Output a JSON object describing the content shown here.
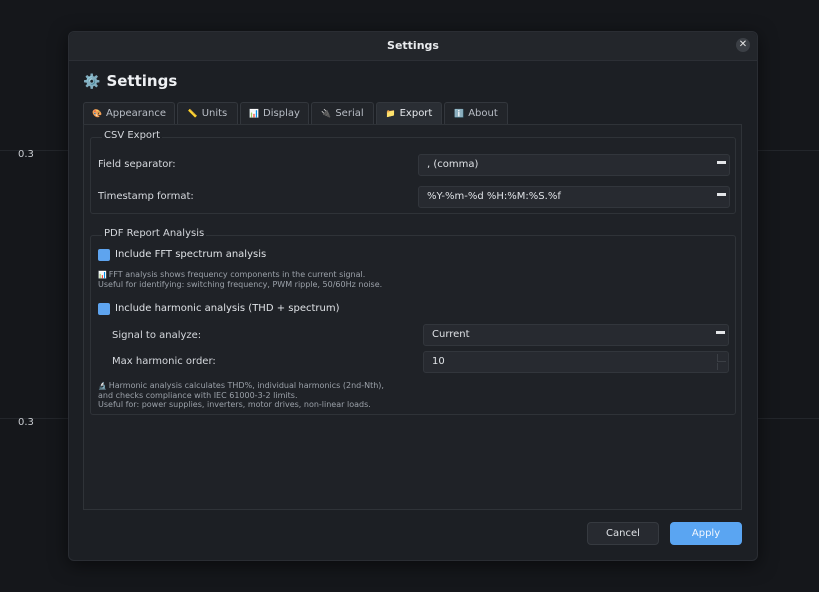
{
  "background": {
    "tick_top": "0.3",
    "tick_bottom": "0.3"
  },
  "dialog": {
    "title": "Settings",
    "close_symbol": "✕",
    "heading_icon": "⚙️",
    "heading": "Settings"
  },
  "tabs": [
    {
      "icon": "🎨",
      "label": "Appearance",
      "active": false
    },
    {
      "icon": "📏",
      "label": "Units",
      "active": false
    },
    {
      "icon": "📊",
      "label": "Display",
      "active": false
    },
    {
      "icon": "🔌",
      "label": "Serial",
      "active": false
    },
    {
      "icon": "📁",
      "label": "Export",
      "active": true
    },
    {
      "icon": "ℹ️",
      "label": "About",
      "active": false
    }
  ],
  "csv_export": {
    "title": "CSV Export",
    "field_separator_label": "Field separator:",
    "field_separator_value": ", (comma)",
    "timestamp_format_label": "Timestamp format:",
    "timestamp_format_value": "%Y-%m-%d %H:%M:%S.%f"
  },
  "pdf_report": {
    "title": "PDF Report Analysis",
    "fft_label": "Include FFT spectrum analysis",
    "fft_checked": true,
    "fft_note_icon": "📊",
    "fft_note_line1": "FFT analysis shows frequency components in the current signal.",
    "fft_note_line2": "Useful for identifying: switching frequency, PWM ripple, 50/60Hz noise.",
    "harmonic_label": "Include harmonic analysis (THD + spectrum)",
    "harmonic_checked": true,
    "signal_label": "Signal to analyze:",
    "signal_value": "Current",
    "max_order_label": "Max harmonic order:",
    "max_order_value": "10",
    "harmonic_note_icon": "🔬",
    "harmonic_note_line1": "Harmonic analysis calculates THD%, individual harmonics (2nd-Nth),",
    "harmonic_note_line2": "and checks compliance with IEC 61000-3-2 limits.",
    "harmonic_note_line3": "Useful for: power supplies, inverters, motor drives, non-linear loads."
  },
  "buttons": {
    "cancel": "Cancel",
    "apply": "Apply"
  },
  "colors": {
    "accent": "#5aa5f2",
    "checkbox": "#5ea4ef"
  }
}
